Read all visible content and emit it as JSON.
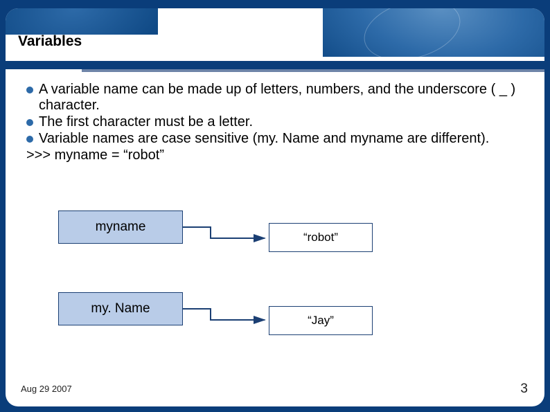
{
  "title": "Variables",
  "bullets": [
    "A variable name can be made up of letters, numbers, and the underscore ( _ ) character.",
    "The first character must be a letter.",
    "Variable names are case sensitive (my. Name and myname are different)."
  ],
  "code_line": ">>> myname = “robot”",
  "diagram": {
    "var1": "myname",
    "val1": "“robot”",
    "var2": "my. Name",
    "val2": "“Jay”"
  },
  "footer": {
    "date": "Aug 29 2007",
    "page": "3"
  }
}
